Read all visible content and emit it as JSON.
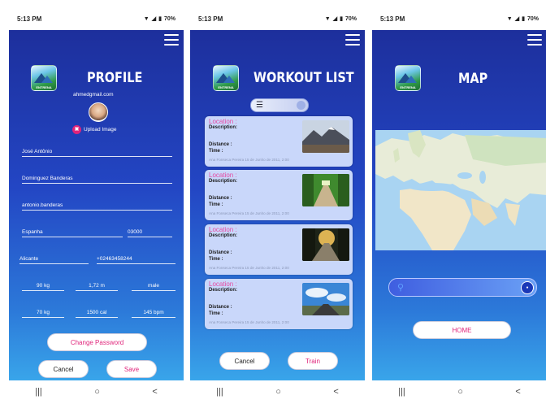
{
  "status_bar": {
    "time": "5:13 PM",
    "battery": "70%"
  },
  "profile": {
    "title": "PROFILE",
    "email": "ahmedgmail.com",
    "upload_label": "Upload Image",
    "fields": {
      "first_name": "José Antônio",
      "last_name": "Dominguez Banderas",
      "username": "antonio.banderas",
      "country": "Espanha",
      "postal_code": "03000",
      "city": "Alicante",
      "phone": "+02463458244",
      "weight": "90 kg",
      "height": "1,72 m",
      "gender": "male",
      "target_weight": "70 kg",
      "calories": "1500 cal",
      "heart_rate": "145 bpm"
    },
    "change_password_label": "Change Password",
    "cancel_label": "Cancel",
    "save_label": "Save"
  },
  "workout_list": {
    "title": "WORKOUT LIST",
    "cards": [
      {
        "location": "Location :",
        "description": "Description:",
        "distance": "Distance :",
        "time": "Time :",
        "meta": "Ana Fonseca Pereira 15 de Junho de 2011, 2:00"
      },
      {
        "location": "Location :",
        "description": "Description:",
        "distance": "Distance :",
        "time": "Time :",
        "meta": "Ana Fonseca Pereira 15 de Junho de 2011, 2:00"
      },
      {
        "location": "Location :",
        "description": "Description:",
        "distance": "Distance :",
        "time": "Time :",
        "meta": "Ana Fonseca Pereira 15 de Junho de 2011, 2:00"
      },
      {
        "location": "Location :",
        "description": "Description:",
        "distance": "Distance :",
        "time": "Time :",
        "meta": "Ana Fonseca Pereira 15 de Junho de 2011, 2:00"
      }
    ],
    "cancel_label": "Cancel",
    "train_label": "Train"
  },
  "map_screen": {
    "title": "MAP",
    "home_label": "HOME"
  },
  "nav": {
    "recent": "|||",
    "home": "○",
    "back": "<"
  },
  "colors": {
    "gradient_top": "#1d2f9c",
    "gradient_bottom": "#39a5ea",
    "accent_pink": "#e0247a",
    "card_bg": "#c9d7fa"
  }
}
